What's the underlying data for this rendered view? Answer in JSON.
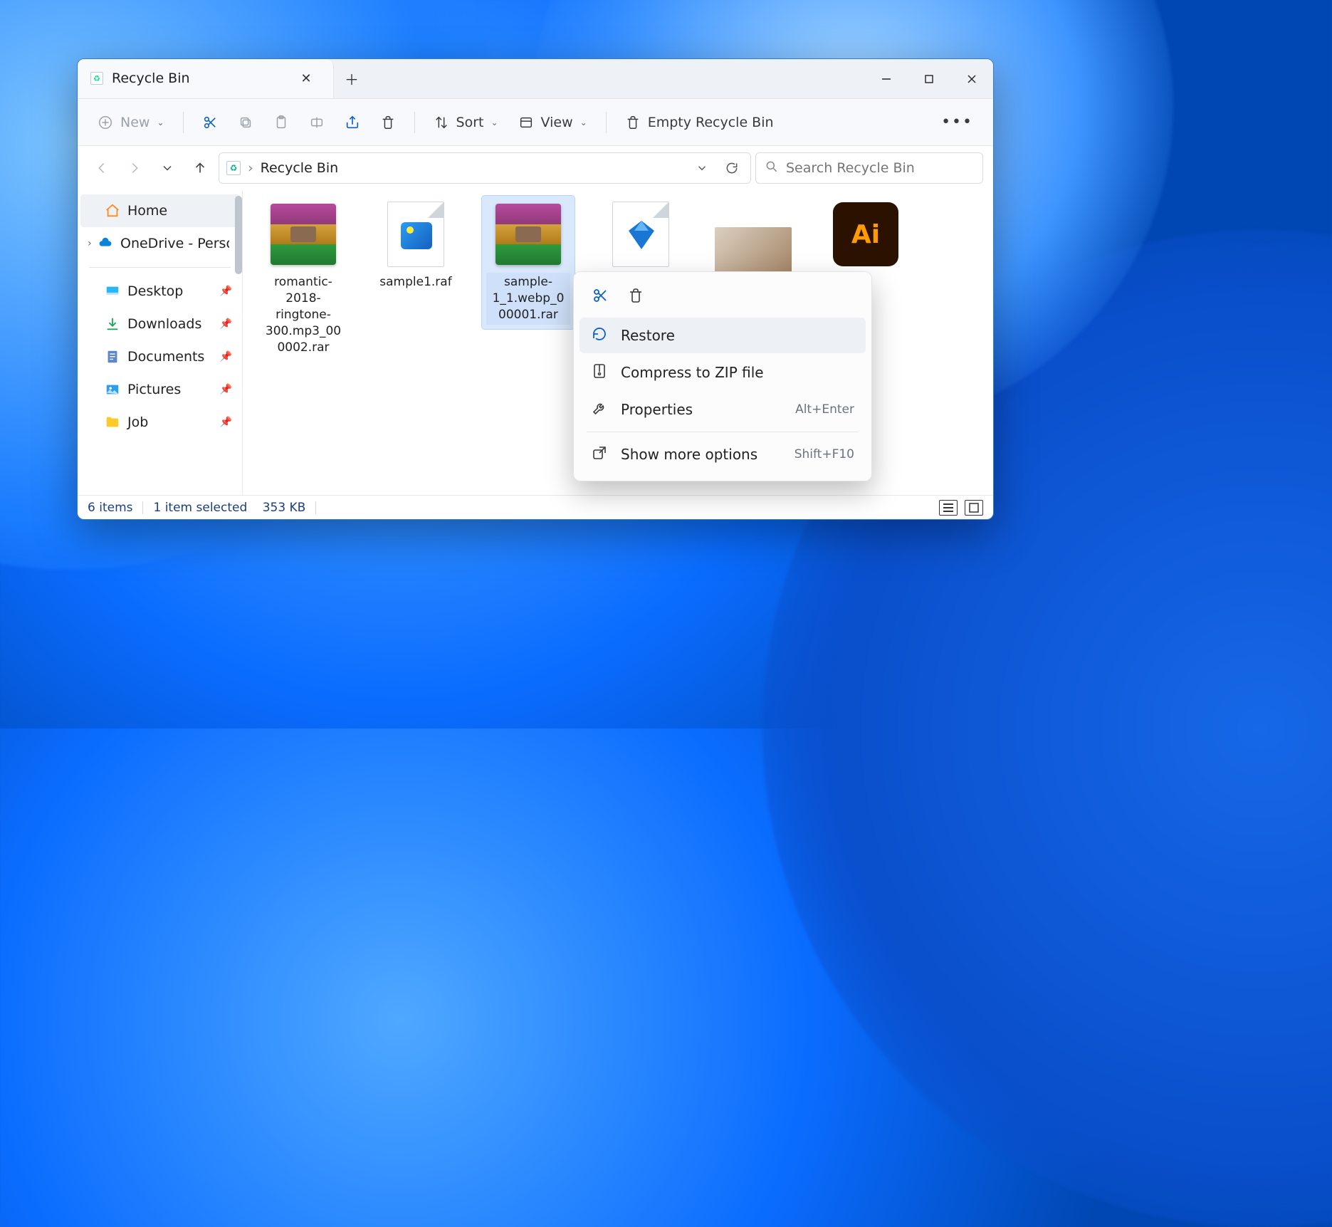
{
  "tab": {
    "title": "Recycle Bin"
  },
  "toolbar": {
    "new": "New",
    "sort": "Sort",
    "view": "View",
    "empty": "Empty Recycle Bin"
  },
  "breadcrumb": {
    "location": "Recycle Bin"
  },
  "search": {
    "placeholder": "Search Recycle Bin"
  },
  "sidebar": {
    "home": "Home",
    "onedrive": "OneDrive - Personal",
    "desktop": "Desktop",
    "downloads": "Downloads",
    "documents": "Documents",
    "pictures": "Pictures",
    "job": "Job"
  },
  "files": [
    {
      "name": "romantic-2018-ringtone-300.mp3_000002.rar"
    },
    {
      "name": "sample1.raf"
    },
    {
      "name": "sample-1_1.webp_000001.rar"
    }
  ],
  "context": {
    "restore": "Restore",
    "compress": "Compress to ZIP file",
    "properties": "Properties",
    "properties_shortcut": "Alt+Enter",
    "more": "Show more options",
    "more_shortcut": "Shift+F10"
  },
  "status": {
    "count": "6 items",
    "selected": "1 item selected",
    "size": "353 KB"
  },
  "ai_label": "Ai"
}
